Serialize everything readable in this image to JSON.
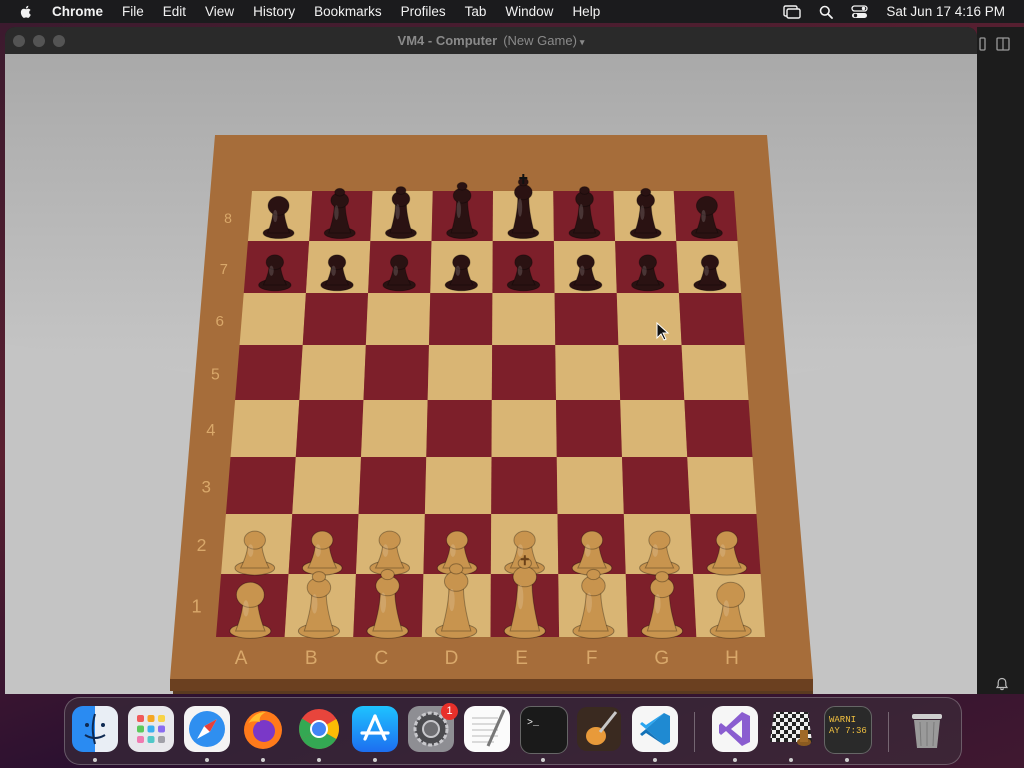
{
  "menubar": {
    "app_name": "Chrome",
    "items": [
      "File",
      "Edit",
      "View",
      "History",
      "Bookmarks",
      "Profiles",
      "Tab",
      "Window",
      "Help"
    ],
    "clock": "Sat Jun 17  4:16 PM"
  },
  "window": {
    "title": "VM4 - Computer",
    "subtitle": "(New Game)"
  },
  "board": {
    "files": [
      "A",
      "B",
      "C",
      "D",
      "E",
      "F",
      "G",
      "H"
    ],
    "ranks": [
      "8",
      "7",
      "6",
      "5",
      "4",
      "3",
      "2",
      "1"
    ],
    "light_square": "#d9b574",
    "dark_square": "#7d1f2a",
    "frame_color": "#a66d3a",
    "position": {
      "rank8": [
        "R",
        "N",
        "B",
        "Q",
        "K",
        "B",
        "N",
        "R"
      ],
      "rank7": [
        "P",
        "P",
        "P",
        "P",
        "P",
        "P",
        "P",
        "P"
      ],
      "rank2": [
        "P",
        "P",
        "P",
        "P",
        "P",
        "P",
        "P",
        "P"
      ],
      "rank1": [
        "R",
        "N",
        "B",
        "Q",
        "K",
        "B",
        "N",
        "R"
      ]
    },
    "black_piece_color": "#2a1212",
    "white_piece_color": "#c8944e"
  },
  "dock": {
    "apps": [
      "Finder",
      "Launchpad",
      "Safari",
      "Firefox",
      "Chrome",
      "App Store",
      "System Settings",
      "TextEdit",
      "Terminal",
      "GarageBand",
      "Visual Studio Code",
      "Visual Studio",
      "Chess",
      "Console",
      "Trash"
    ],
    "settings_badge": "1",
    "console_text_line1": "WARNI",
    "console_text_line2": "AY 7:36"
  }
}
